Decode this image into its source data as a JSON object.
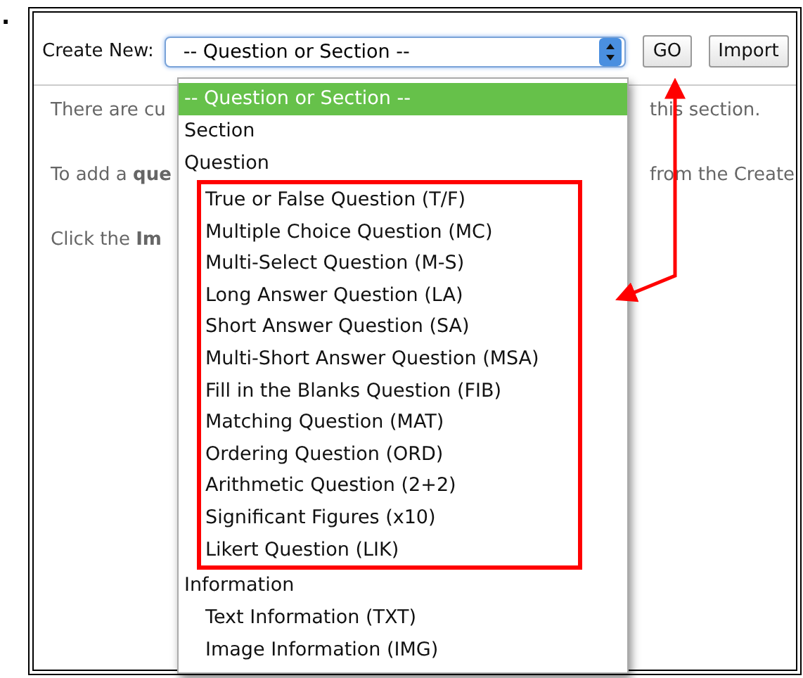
{
  "fragment": ".",
  "create_new": {
    "label": "Create New:",
    "select_value": "-- Question or Section --",
    "buttons": [
      "GO",
      "Import"
    ]
  },
  "body_lines": [
    {
      "left": "There are cu",
      "right": "this section."
    },
    {
      "left": "To add a **que**",
      "right": "from the Create"
    },
    {
      "left": "Click the **Im**"
    }
  ],
  "dropdown": {
    "options": [
      {
        "label": "-- Question or Section --",
        "selected": true
      },
      {
        "label": "Section",
        "selected": false
      },
      {
        "label": "Question",
        "selected": false,
        "highlighted": true,
        "children": [
          {
            "label": "True or False Question (T/F)",
            "selected": false
          },
          {
            "label": "Multiple Choice Question (MC)",
            "selected": false
          },
          {
            "label": "Multi-Select Question (M-S)",
            "selected": false
          },
          {
            "label": "Long Answer Question (LA)",
            "selected": false
          },
          {
            "label": "Short Answer Question (SA)",
            "selected": false
          },
          {
            "label": "Multi-Short Answer Question (MSA)",
            "selected": false
          },
          {
            "label": "Fill in the Blanks Question (FIB)",
            "selected": false
          },
          {
            "label": "Matching Question (MAT)",
            "selected": false
          },
          {
            "label": "Ordering Question (ORD)",
            "selected": false
          },
          {
            "label": "Arithmetic Question (2+2)",
            "selected": false
          },
          {
            "label": "Significant Figures (x10)",
            "selected": false
          },
          {
            "label": "Likert Question (LIK)",
            "selected": false
          }
        ]
      },
      {
        "label": "Information",
        "selected": false,
        "highlighted": false,
        "children": [
          {
            "label": "Text Information (TXT)",
            "selected": false
          },
          {
            "label": "Image Information (IMG)",
            "selected": false
          }
        ]
      }
    ]
  }
}
